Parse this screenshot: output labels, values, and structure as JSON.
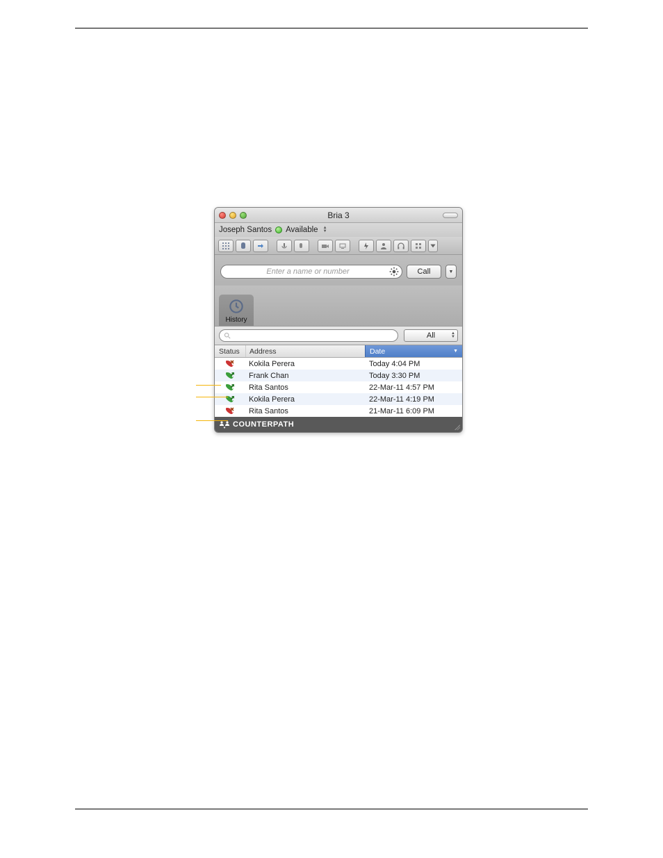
{
  "window": {
    "title": "Bria 3",
    "user_name": "Joseph Santos",
    "presence_label": "Available"
  },
  "toolbar_icons": [
    "dialpad-icon",
    "hand-icon",
    "transfer-icon",
    "mute-icon",
    "record-icon",
    "webcam-icon",
    "screenshare-icon",
    "flash-icon",
    "contact-icon",
    "headset-icon",
    "grid-icon",
    "dropdown-icon"
  ],
  "dial": {
    "placeholder": "Enter a name or number",
    "call_label": "Call"
  },
  "tab": {
    "label": "History"
  },
  "filter": {
    "label": "All"
  },
  "columns": {
    "status": "Status",
    "address": "Address",
    "date": "Date"
  },
  "rows": [
    {
      "status": "missed",
      "address": "Kokila Perera",
      "date": "Today 4:04 PM"
    },
    {
      "status": "outgoing",
      "address": "Frank Chan",
      "date": "Today 3:30 PM"
    },
    {
      "status": "outgoing",
      "address": "Rita Santos",
      "date": "22-Mar-11 4:57 PM"
    },
    {
      "status": "outgoing",
      "address": "Kokila Perera",
      "date": "22-Mar-11 4:19 PM"
    },
    {
      "status": "missed",
      "address": "Rita Santos",
      "date": "21-Mar-11 6:09 PM"
    }
  ],
  "brand": "COUNTERPATH"
}
